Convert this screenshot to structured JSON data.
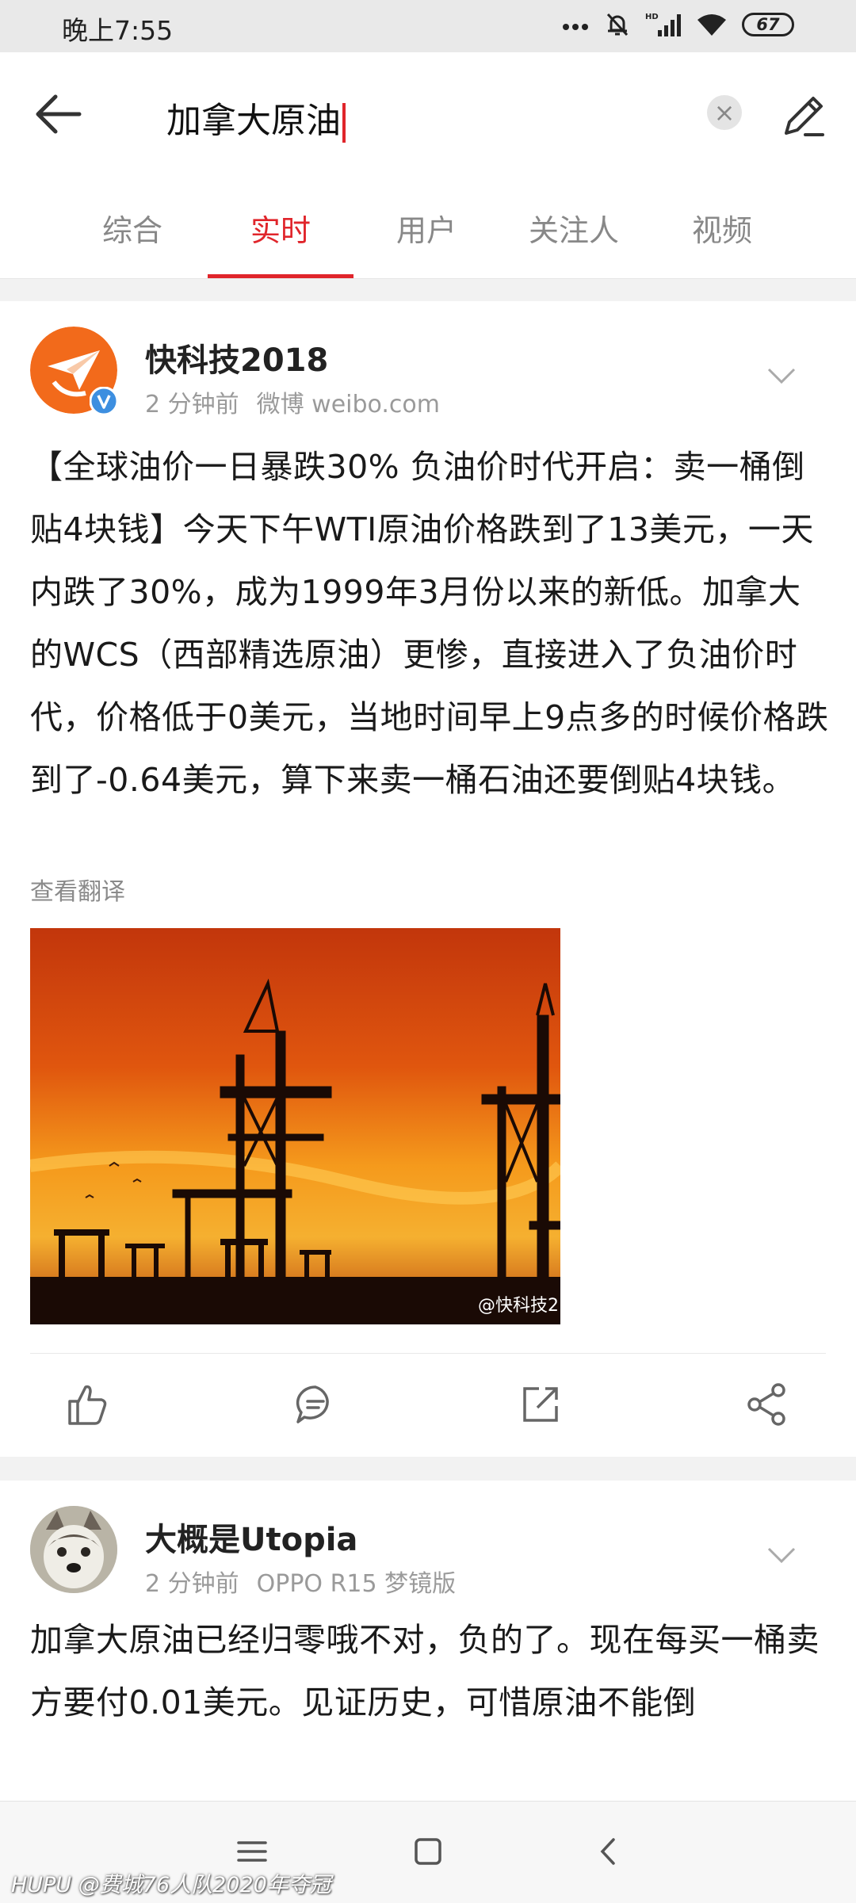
{
  "status": {
    "time": "晚上7:55",
    "network": "HD",
    "battery": "67"
  },
  "search": {
    "query": "加拿大原油"
  },
  "tabs": [
    "综合",
    "实时",
    "用户",
    "关注人",
    "视频"
  ],
  "posts": [
    {
      "username": "快科技2018",
      "time": "2 分钟前",
      "source": "微博 weibo.com",
      "verified": true,
      "text": "【全球油价一日暴跌30% 负油价时代开启：卖一桶倒贴4块钱】今天下午WTI原油价格跌到了13美元，一天内跌了30%，成为1999年3月份以来的新低。加拿大的WCS（西部精选原油）更惨，直接进入了负油价时代，价格低于0美元，当地时间早上9点多的时候价格跌到了-0.64美元，算下来卖一桶石油还要倒贴4块钱。",
      "translate": "查看翻译",
      "image_watermark": "@快科技2"
    },
    {
      "username": "大概是Utopia",
      "time": "2 分钟前",
      "source": "OPPO R15 梦镜版",
      "text": "加拿大原油已经归零哦不对，负的了。现在每买一桶卖方要付0.01美元。见证历史，可惜原油不能倒"
    }
  ],
  "footer_watermark": "HUPU @费城76人队2020年夺冠",
  "colors": {
    "accent": "#e0252b",
    "avatar_orange": "#f26a1b",
    "verified_blue": "#3d8fe0"
  }
}
